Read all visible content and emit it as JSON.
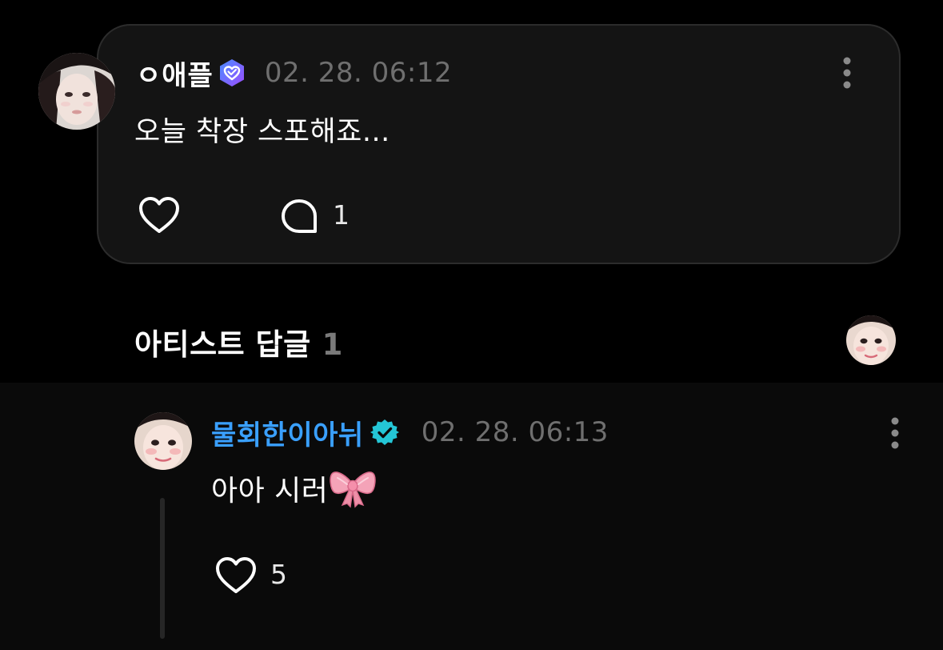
{
  "post": {
    "username": "ㅇ애플",
    "timestamp": "02. 28. 06:12",
    "body": "오늘 착장 스포해죠...",
    "comment_count": "1",
    "icons": {
      "badge": "membership-heart-badge-icon",
      "like": "heart-outline-icon",
      "comment": "speech-bubble-icon",
      "more": "vertical-dots-icon"
    }
  },
  "artist_replies": {
    "title": "아티스트 답글",
    "count": "1"
  },
  "reply": {
    "username": "물회한이아뉘",
    "timestamp": "02. 28. 06:13",
    "body": "아아 시러",
    "like_count": "5",
    "icons": {
      "badge": "verified-check-badge-icon",
      "emoji": "ribbon-bow-emoji",
      "like": "heart-outline-icon",
      "more": "vertical-dots-icon"
    }
  },
  "colors": {
    "background": "#000000",
    "card": "#141414",
    "card_border": "#2c2c2c",
    "reply_username": "#3aa0ff",
    "verified_badge": "#24c6d6",
    "muted_text": "#6f6f6f"
  }
}
